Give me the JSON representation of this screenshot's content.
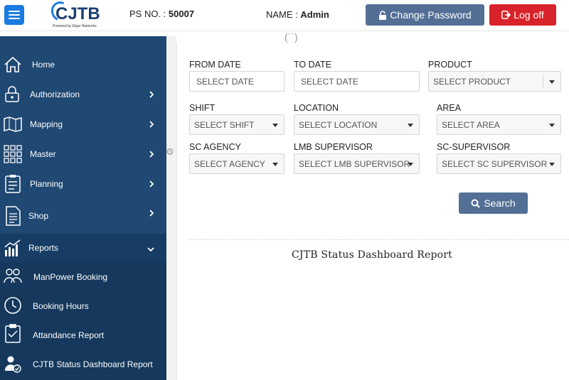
{
  "header": {
    "logo_text": "CJTB",
    "logo_sub": "Powered by Elgar Networks",
    "ps_label": "PS NO. : ",
    "ps_value": "50007",
    "name_label": "NAME : ",
    "name_value": "Admin",
    "change_password_label": "Change Password",
    "logout_label": "Log off",
    "colors": {
      "hamburger": "#1a7be0",
      "change_password": "#546f96",
      "logout": "#d9232a"
    }
  },
  "sidebar": {
    "background": "#1f4872",
    "items": [
      {
        "label": "Home",
        "icon": "home-icon"
      },
      {
        "label": "Authorization",
        "icon": "lock-icon"
      },
      {
        "label": "Mapping",
        "icon": "map-icon"
      },
      {
        "label": "Master",
        "icon": "grid-icon"
      },
      {
        "label": "Planning",
        "icon": "clipboard-icon"
      },
      {
        "label": "Shop",
        "icon": "document-icon"
      },
      {
        "label": "Reports",
        "icon": "chart-icon"
      }
    ],
    "report_items": [
      {
        "label": "ManPower Booking",
        "icon": "users-icon"
      },
      {
        "label": "Booking Hours",
        "icon": "clock-icon"
      },
      {
        "label": "Attandance Report",
        "icon": "checklist-icon"
      },
      {
        "label": "CJTB Status Dashboard Report",
        "icon": "user-check-icon"
      }
    ]
  },
  "filters": {
    "from_date": {
      "label": "FROM DATE",
      "placeholder": "SELECT DATE"
    },
    "to_date": {
      "label": "TO DATE",
      "placeholder": "SELECT DATE"
    },
    "product": {
      "label": "PRODUCT",
      "value": "SELECT PRODUCT"
    },
    "shift": {
      "label": "SHIFT",
      "value": "SELECT SHIFT"
    },
    "location": {
      "label": "LOCATION",
      "value": "SELECT LOCATION"
    },
    "area": {
      "label": "AREA",
      "value": "SELECT AREA"
    },
    "sc_agency": {
      "label": "SC AGENCY",
      "value": "SELECT AGENCY"
    },
    "lmb_supervisor": {
      "label": "LMB SUPERVISOR",
      "value": "SELECT LMB SUPERVISOR"
    },
    "sc_supervisor": {
      "label": "SC-SUPERVISOR",
      "value": "SELECT SC SUPERVISOR"
    }
  },
  "search_label": "Search",
  "report_title": "CJTB Status Dashboard Report"
}
